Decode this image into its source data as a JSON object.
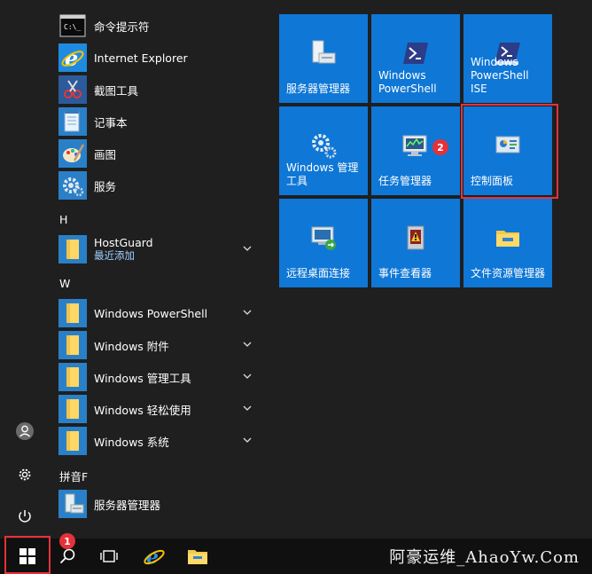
{
  "apps": [
    {
      "name": "命令提示符",
      "icon": "cmd-icon"
    },
    {
      "name": "Internet Explorer",
      "icon": "ie-icon"
    },
    {
      "name": "截图工具",
      "icon": "snipping-tool-icon"
    },
    {
      "name": "记事本",
      "icon": "notepad-icon"
    },
    {
      "name": "画图",
      "icon": "paint-icon"
    },
    {
      "name": "服务",
      "icon": "services-gear-icon"
    }
  ],
  "groups": {
    "h": {
      "letter": "H",
      "items": [
        {
          "name": "HostGuard",
          "sub": "最近添加",
          "icon": "folder-icon"
        }
      ]
    },
    "w": {
      "letter": "W",
      "items": [
        {
          "name": "Windows PowerShell",
          "icon": "folder-icon"
        },
        {
          "name": "Windows 附件",
          "icon": "folder-icon"
        },
        {
          "name": "Windows 管理工具",
          "icon": "folder-icon"
        },
        {
          "name": "Windows 轻松使用",
          "icon": "folder-icon"
        },
        {
          "name": "Windows 系统",
          "icon": "folder-icon"
        }
      ]
    },
    "pinyin": {
      "letter": "拼音F",
      "items": [
        {
          "name": "服务器管理器",
          "icon": "server-manager-icon"
        }
      ]
    }
  },
  "tiles": [
    {
      "label": "服务器管理器",
      "icon": "server-manager-icon"
    },
    {
      "label": "Windows PowerShell",
      "icon": "powershell-icon"
    },
    {
      "label": "Windows PowerShell ISE",
      "icon": "powershell-ise-icon"
    },
    {
      "label": "Windows 管理工具",
      "icon": "admin-tools-icon"
    },
    {
      "label": "任务管理器",
      "icon": "task-manager-icon"
    },
    {
      "label": "控制面板",
      "icon": "control-panel-icon"
    },
    {
      "label": "远程桌面连接",
      "icon": "remote-desktop-icon"
    },
    {
      "label": "事件查看器",
      "icon": "event-viewer-icon"
    },
    {
      "label": "文件资源管理器",
      "icon": "file-explorer-icon"
    }
  ],
  "badges": {
    "one": "1",
    "two": "2"
  },
  "watermark": "阿豪运维_AhaoYw.Com",
  "colors": {
    "tile": "#0f77d6",
    "highlight": "#e6313a",
    "background": "#1f1f1f",
    "taskbar": "#101010"
  }
}
